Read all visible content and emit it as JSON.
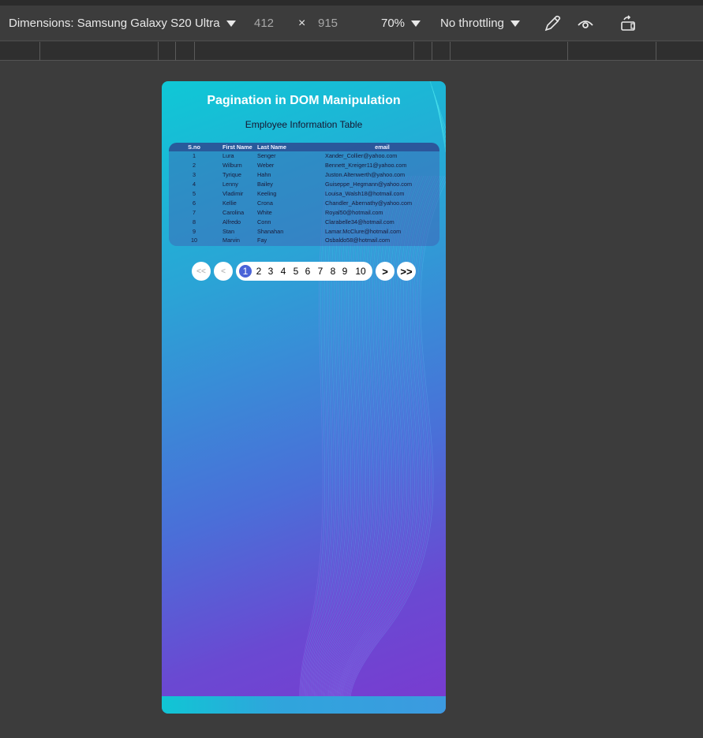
{
  "devtools": {
    "dimensions_label": "Dimensions: Samsung Galaxy S20 Ultra",
    "width": "412",
    "times": "×",
    "height": "915",
    "zoom": "70%",
    "throttling": "No throttling",
    "icons": [
      "eyedropper-icon",
      "eye-icon",
      "rotate-icon"
    ]
  },
  "page": {
    "title": "Pagination in DOM Manipulation",
    "subtitle": "Employee Information Table",
    "table": {
      "headers": [
        "S.no",
        "First Name",
        "Last Name",
        "email"
      ],
      "rows": [
        [
          "1",
          "Lura",
          "Senger",
          "Xander_Collier@yahoo.com"
        ],
        [
          "2",
          "Wilburn",
          "Weber",
          "Bennett_Kreiger11@yahoo.com"
        ],
        [
          "3",
          "Tyrique",
          "Hahn",
          "Juston.Altenwerth@yahoo.com"
        ],
        [
          "4",
          "Lenny",
          "Bailey",
          "Guiseppe_Hegmann@yahoo.com"
        ],
        [
          "5",
          "Vladimir",
          "Keeling",
          "Louisa_Walsh18@hotmail.com"
        ],
        [
          "6",
          "Kellie",
          "Crona",
          "Chandler_Abernathy@yahoo.com"
        ],
        [
          "7",
          "Carolina",
          "White",
          "Royal50@hotmail.com"
        ],
        [
          "8",
          "Alfredo",
          "Conn",
          "Clarabelle34@hotmail.com"
        ],
        [
          "9",
          "Stan",
          "Shanahan",
          "Lamar.McClure@hotmail.com"
        ],
        [
          "10",
          "Marvin",
          "Fay",
          "Osbaldo58@hotmail.com"
        ]
      ]
    },
    "pagination": {
      "first": "<<",
      "prev": "<",
      "pages": [
        "1",
        "2",
        "3",
        "4",
        "5",
        "6",
        "7",
        "8",
        "9",
        "10"
      ],
      "current": "1",
      "next": ">",
      "last": ">>"
    }
  },
  "colors": {
    "active_page": "#4a63d8",
    "devtools_bg": "#3c3c3c"
  }
}
